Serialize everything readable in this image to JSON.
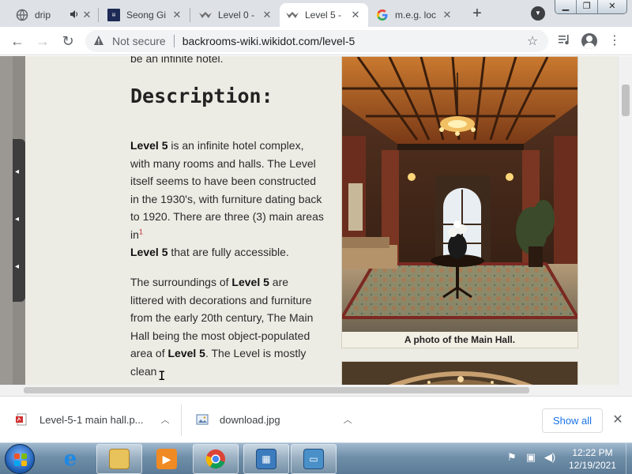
{
  "browser": {
    "tabs": [
      {
        "title": "drip",
        "extra_icon": "speaker-icon",
        "active": false
      },
      {
        "title": "Seong Gi",
        "active": false
      },
      {
        "title": "Level 0 -",
        "active": false
      },
      {
        "title": "Level 5 -",
        "active": true
      },
      {
        "title": "m.e.g. loc",
        "active": false
      }
    ],
    "new_tab": "+",
    "address": {
      "security_label": "Not secure",
      "url": "backrooms-wiki.wikidot.com/level-5"
    }
  },
  "article": {
    "cut_line": "be an infinite hotel.",
    "heading": "Description:",
    "p1": {
      "b1": "Level 5",
      "t1": " is an infinite hotel complex, with many rooms and halls. The Level itself seems to have been constructed in the 1930's, with furniture dating back to 1920. There are three (3) main areas in",
      "footnote": "1",
      "b2": "Level 5",
      "t2": " that are fully accessible."
    },
    "p2": {
      "t1": "The surroundings of ",
      "b1": "Level 5",
      "t2": " are littered with decorations and furniture from the early 20th century, The Main Hall being the most object-populated area of ",
      "b2": "Level 5",
      "t3": ". The Level is mostly clean"
    },
    "figure_caption": "A photo of the Main Hall."
  },
  "downloads": {
    "items": [
      {
        "name": "Level-5-1 main hall.p...",
        "icon": "pdf-file-icon"
      },
      {
        "name": "download.jpg",
        "icon": "image-file-icon"
      }
    ],
    "show_all": "Show all"
  },
  "taskbar": {
    "time": "12:22 PM",
    "date": "12/19/2021"
  },
  "colors": {
    "tabstrip": "#dee1e6",
    "page_background": "#ecebe4",
    "link_blue": "#1a73e8",
    "taskbar": "#6f8ea8"
  }
}
